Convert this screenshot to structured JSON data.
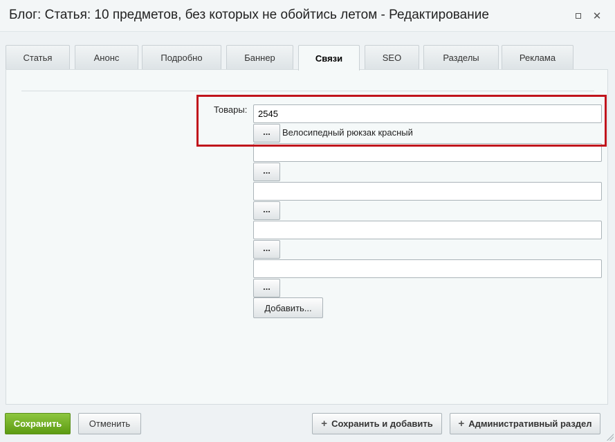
{
  "window": {
    "title": "Блог: Статья: 10 предметов, без которых не обойтись летом - Редактирование"
  },
  "tabs": [
    {
      "label": "Статья"
    },
    {
      "label": "Анонс"
    },
    {
      "label": "Подробно"
    },
    {
      "label": "Баннер"
    },
    {
      "label": "Связи"
    },
    {
      "label": "SEO"
    },
    {
      "label": "Разделы"
    },
    {
      "label": "Реклама"
    }
  ],
  "active_tab": "Связи",
  "form": {
    "products_label": "Товары:",
    "rows": [
      {
        "value": "2545",
        "button": "...",
        "item_name": "Велосипедный рюкзак красный"
      },
      {
        "value": "",
        "button": "..."
      },
      {
        "value": "",
        "button": "..."
      },
      {
        "value": "",
        "button": "..."
      },
      {
        "value": "",
        "button": "..."
      }
    ],
    "add_button": "Добавить..."
  },
  "footer": {
    "save": "Сохранить",
    "cancel": "Отменить",
    "save_and_add": "Сохранить и добавить",
    "admin_section": "Административный раздел"
  },
  "colors": {
    "accent_green": "#6aa81e",
    "highlight_red": "#c0141c"
  },
  "icons": [
    "maximize-icon",
    "close-icon",
    "plus-icon"
  ]
}
